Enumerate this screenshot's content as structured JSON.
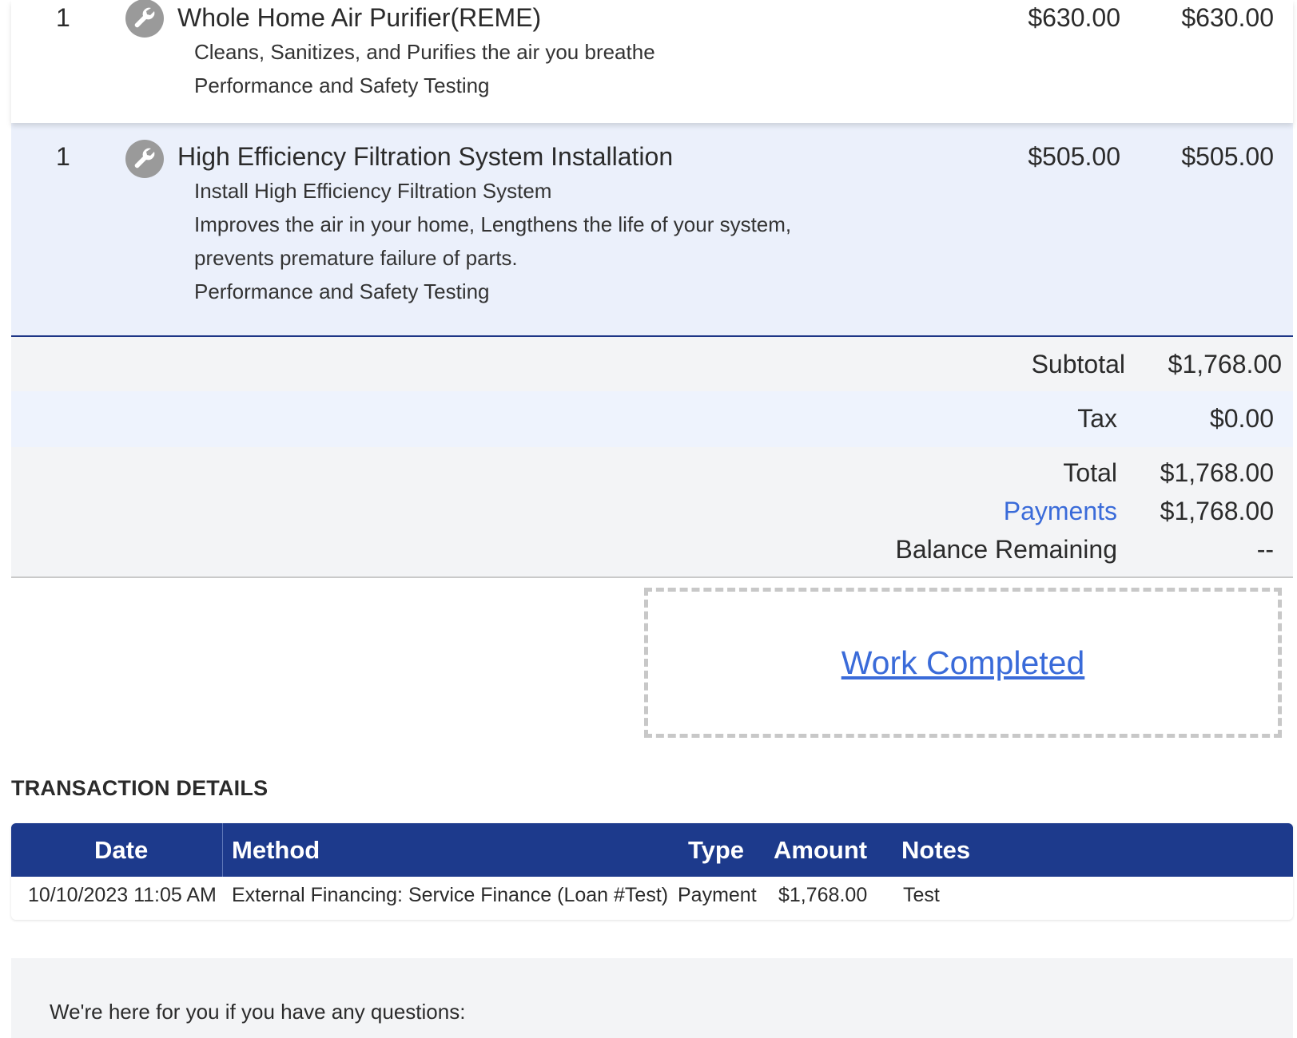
{
  "line_items": [
    {
      "qty": "1",
      "icon": "wrench-icon",
      "title": "Whole Home Air Purifier(REME)",
      "description": [
        "Cleans, Sanitizes, and Purifies the air you breathe",
        "Performance and Safety Testing"
      ],
      "price": "$630.00",
      "total": "$630.00"
    },
    {
      "qty": "1",
      "icon": "wrench-icon",
      "title": "High Efficiency Filtration System Installation",
      "description": [
        "Install High Efficiency Filtration System",
        "Improves the air in your home, Lengthens the life of your system,",
        "prevents premature failure of parts.",
        "Performance and Safety Testing"
      ],
      "price": "$505.00",
      "total": "$505.00"
    }
  ],
  "totals": {
    "subtotal_label": "Subtotal",
    "subtotal_value": "$1,768.00",
    "tax_label": "Tax",
    "tax_value": "$0.00",
    "total_label": "Total",
    "total_value": "$1,768.00",
    "payments_label": "Payments",
    "payments_value": "$1,768.00",
    "balance_label": "Balance Remaining",
    "balance_value": "--"
  },
  "work_completed_label": "Work Completed",
  "transactions": {
    "title": "TRANSACTION DETAILS",
    "headers": {
      "date": "Date",
      "method": "Method",
      "type": "Type",
      "amount": "Amount",
      "notes": "Notes"
    },
    "rows": [
      {
        "date": "10/10/2023 11:05 AM",
        "method": "External Financing: Service Finance (Loan #Test)",
        "type": "Payment",
        "amount": "$1,768.00",
        "notes": "Test"
      }
    ]
  },
  "footer": {
    "text": "We're here for you if you have any questions:"
  },
  "colors": {
    "link": "#3a6bd9",
    "header_navy": "#1d3a8c",
    "row_highlight": "#ebf0fb"
  }
}
